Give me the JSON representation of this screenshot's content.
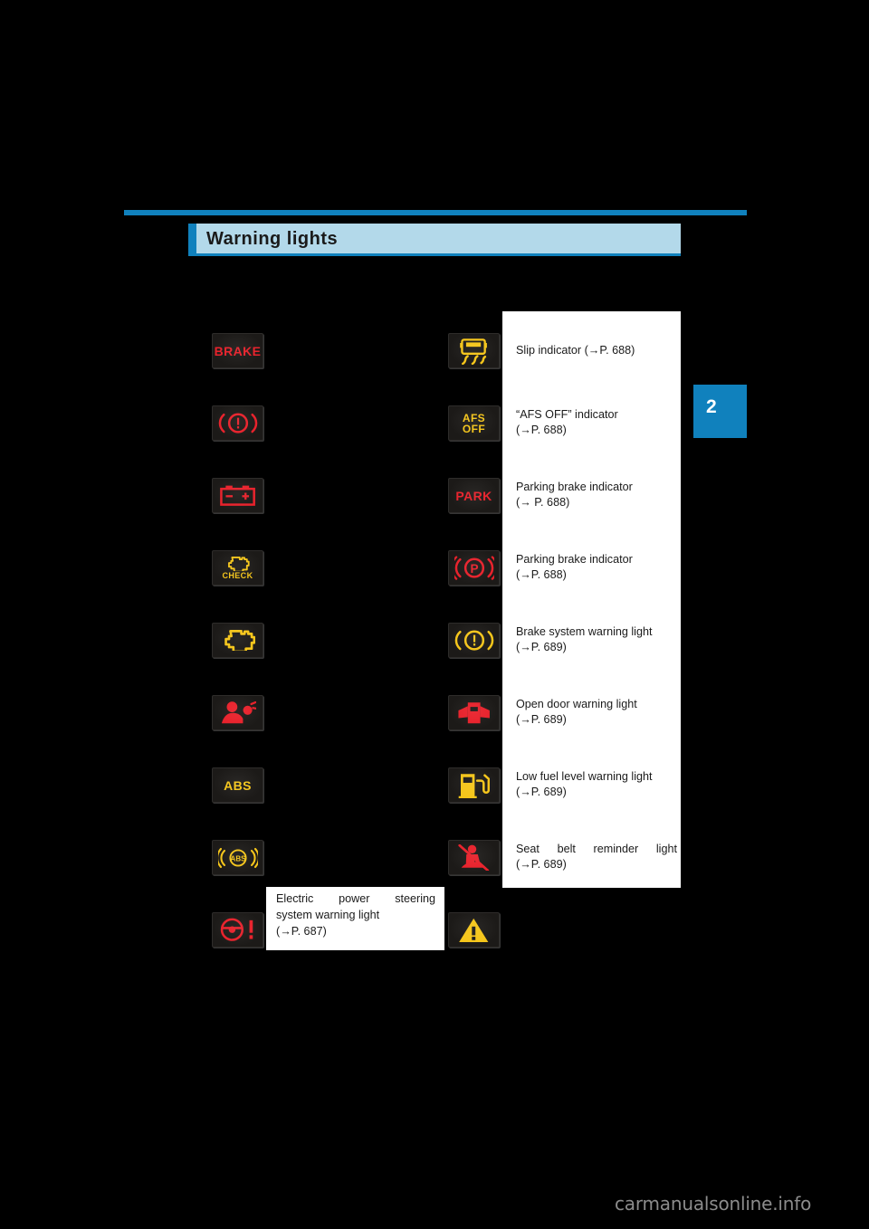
{
  "document": {
    "section_title": "Warning lights",
    "chapter_number": "2",
    "watermark": "carmanualsonline.info"
  },
  "colors": {
    "accent_blue": "#1081bd",
    "header_fill": "#b3d9ea",
    "lamp_bg": "#1c1a18",
    "lamp_red": "#e8202a",
    "lamp_amber": "#f5c518"
  },
  "left_column": [
    {
      "icon": "brake-text-warning-lamp-icon",
      "label": "BRAKE",
      "color": "red"
    },
    {
      "icon": "brake-system-warning-lamp-icon",
      "label": "",
      "color": "red"
    },
    {
      "icon": "charging-system-battery-warning-lamp-icon",
      "label": "",
      "color": "red"
    },
    {
      "icon": "check-engine-check-lamp-icon",
      "label": "CHECK",
      "color": "amber"
    },
    {
      "icon": "malfunction-indicator-engine-lamp-icon",
      "label": "",
      "color": "amber"
    },
    {
      "icon": "srs-airbag-warning-lamp-icon",
      "label": "",
      "color": "red"
    },
    {
      "icon": "abs-text-warning-lamp-icon",
      "label": "ABS",
      "color": "amber"
    },
    {
      "icon": "abs-brackets-warning-lamp-icon",
      "label": "ABS",
      "color": "amber"
    },
    {
      "icon": "electric-power-steering-warning-lamp-icon",
      "label": "",
      "color": "red"
    }
  ],
  "left_caption": {
    "line1": "Electric power steering",
    "line2": "system warning light",
    "line3": "(→P. 687)"
  },
  "right_column": [
    {
      "icon": "slip-indicator-lamp-icon",
      "lamp_label": "",
      "color": "amber",
      "text_lines": [
        "Slip indicator (→P. 688)"
      ],
      "justify": false
    },
    {
      "icon": "afs-off-indicator-lamp-icon",
      "lamp_label": "AFS\nOFF",
      "color": "amber",
      "text_lines": [
        "“AFS OFF” indicator",
        "(→P. 688)"
      ],
      "justify": false
    },
    {
      "icon": "park-text-indicator-lamp-icon",
      "lamp_label": "PARK",
      "color": "red",
      "text_lines": [
        "Parking brake indicator",
        "(→ P. 688)"
      ],
      "justify": false
    },
    {
      "icon": "parking-brake-p-indicator-lamp-icon",
      "lamp_label": "",
      "color": "red",
      "text_lines": [
        "Parking brake indicator",
        "(→P. 688)"
      ],
      "justify": false
    },
    {
      "icon": "brake-system-warning-lamp-icon",
      "lamp_label": "",
      "color": "amber",
      "text_lines": [
        "Brake system warning light",
        "(→P. 689)"
      ],
      "justify": false
    },
    {
      "icon": "open-door-warning-lamp-icon",
      "lamp_label": "",
      "color": "red",
      "text_lines": [
        "Open door warning light",
        "(→P. 689)"
      ],
      "justify": false
    },
    {
      "icon": "low-fuel-level-warning-lamp-icon",
      "lamp_label": "",
      "color": "amber",
      "text_lines": [
        "Low fuel level warning light",
        "(→P. 689)"
      ],
      "justify": false
    },
    {
      "icon": "seat-belt-reminder-lamp-icon",
      "lamp_label": "",
      "color": "red",
      "text_lines": [
        "Seat belt reminder light",
        "(→P. 689)"
      ],
      "justify": true
    },
    {
      "icon": "master-warning-triangle-lamp-icon",
      "lamp_label": "",
      "color": "amber",
      "text_lines": [],
      "justify": false
    }
  ]
}
